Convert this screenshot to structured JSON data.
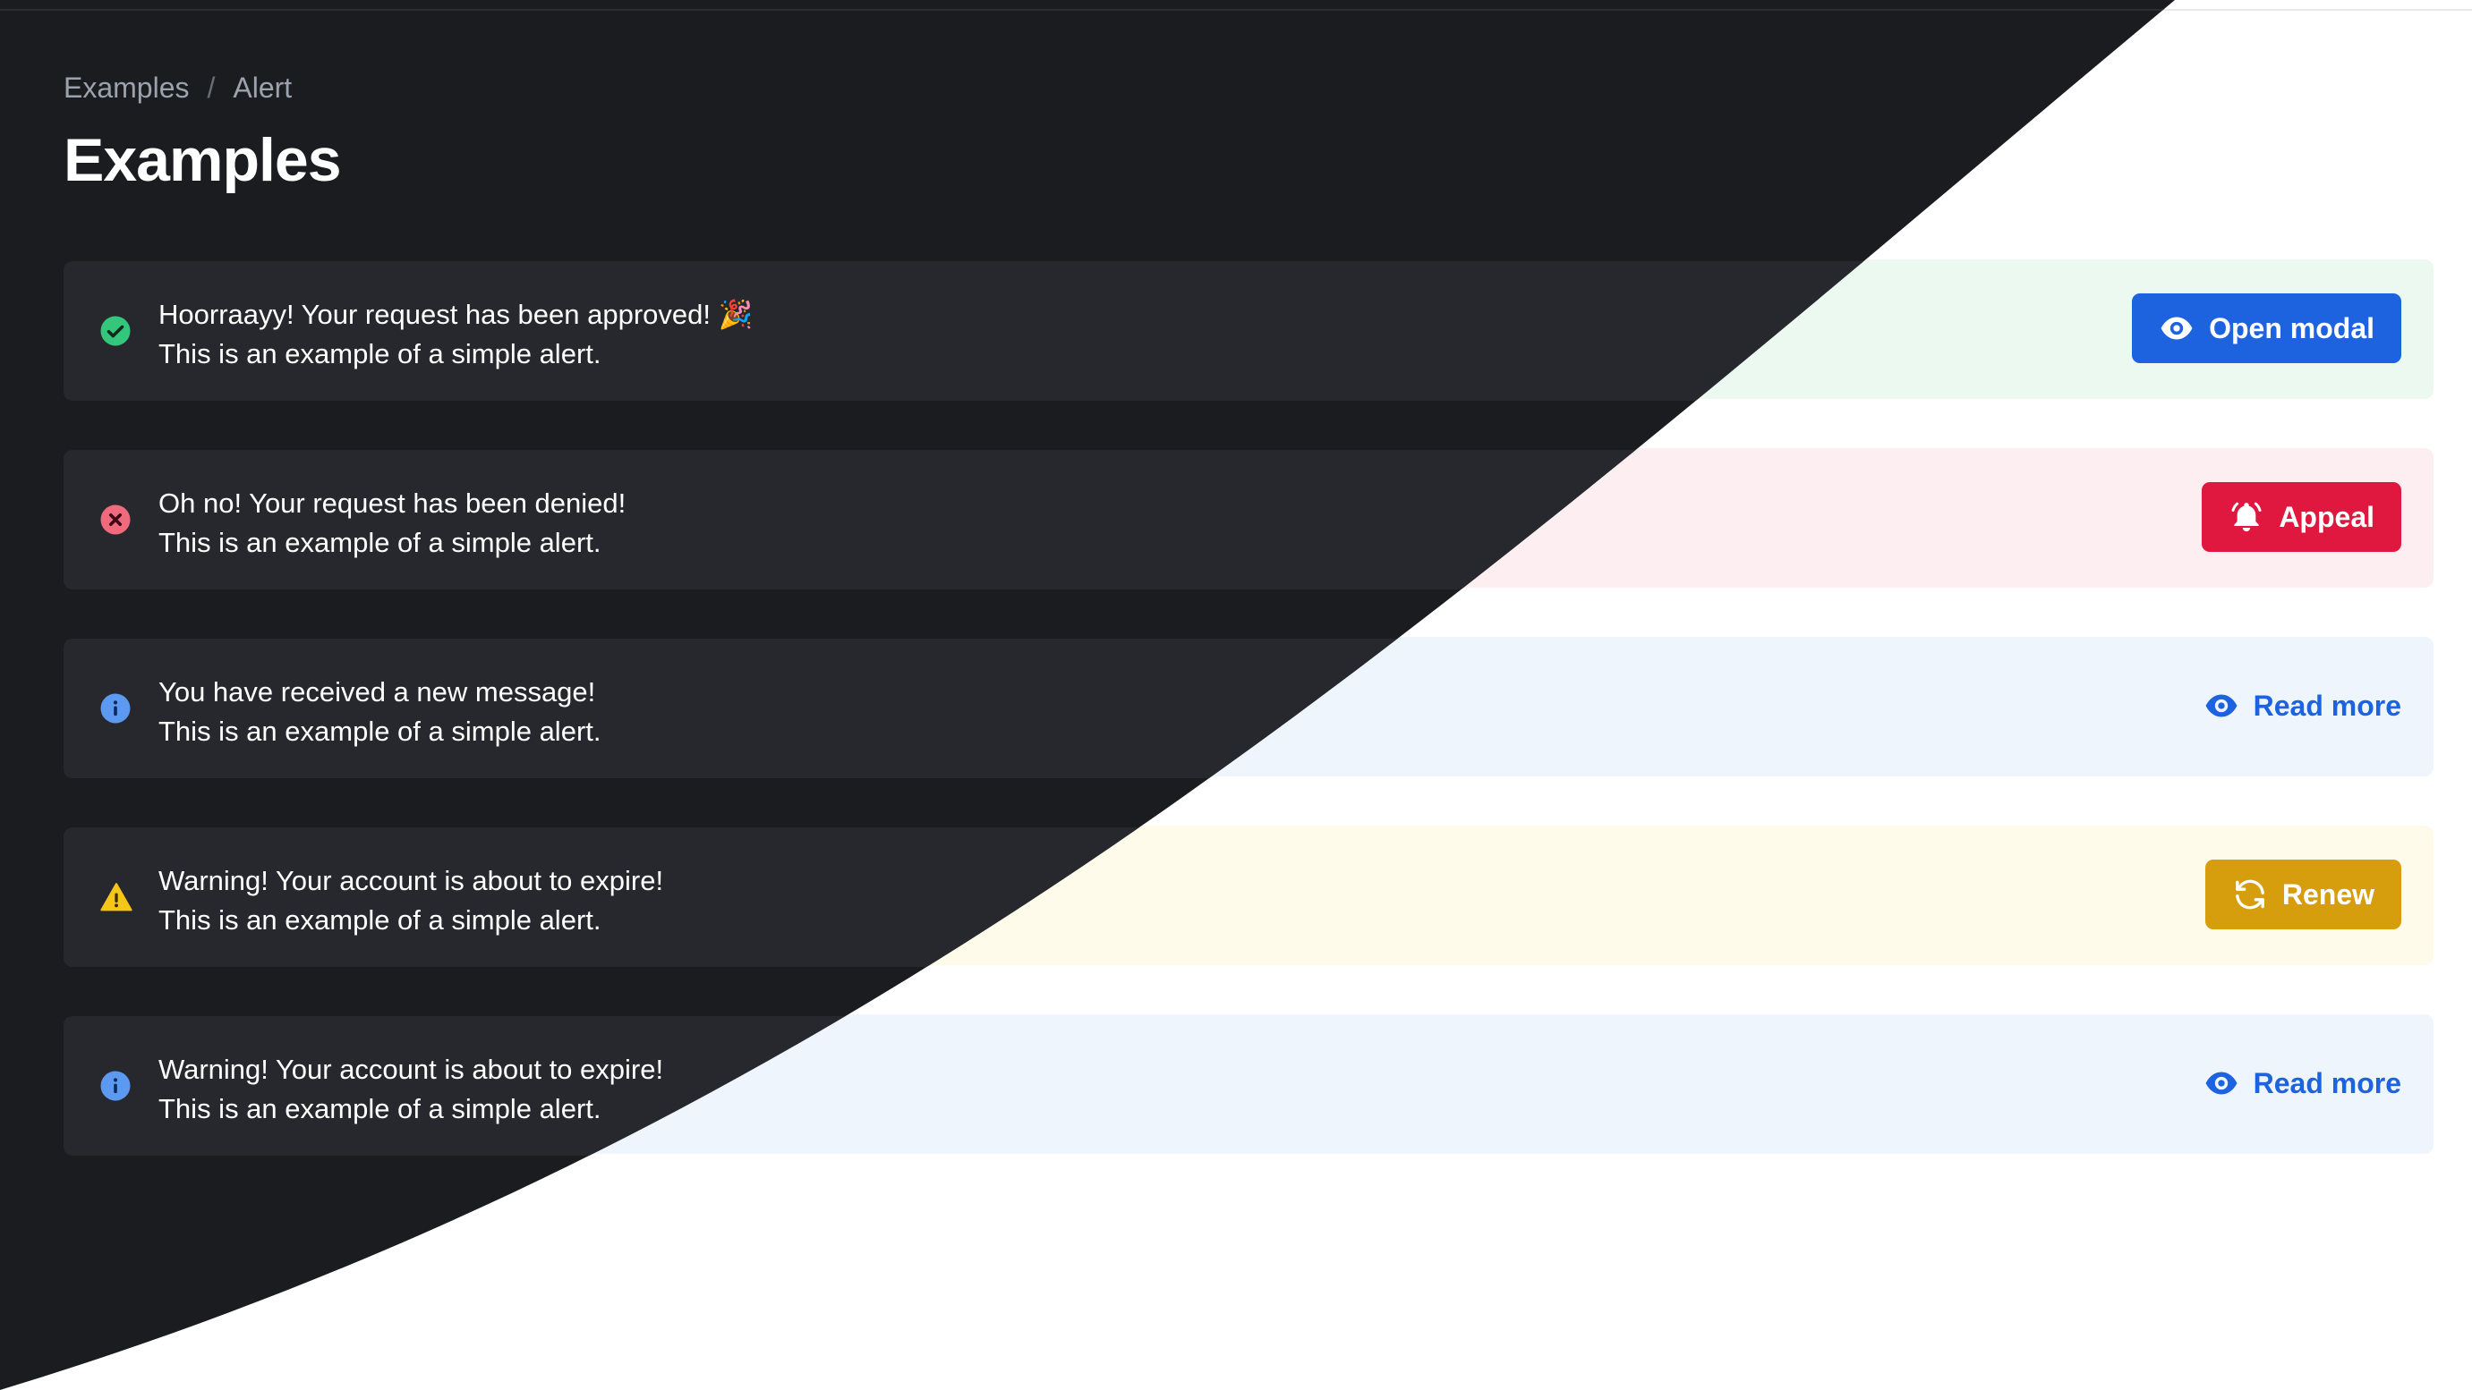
{
  "breadcrumb": {
    "items": [
      "Examples",
      "Alert"
    ],
    "separator": "/"
  },
  "page": {
    "title": "Examples"
  },
  "alerts": [
    {
      "variant": "success",
      "title": "Hoorraayy! Your request has been approved! 🎉",
      "description": "This is an example of a simple alert.",
      "icon": "check-circle-icon",
      "action": {
        "label": "Open modal",
        "icon": "eye-icon",
        "style": "primary"
      }
    },
    {
      "variant": "error",
      "title": "Oh no! Your request has been denied!",
      "description": "This is an example of a simple alert.",
      "icon": "x-circle-icon",
      "action": {
        "label": "Appeal",
        "icon": "bell-icon",
        "style": "danger"
      }
    },
    {
      "variant": "info",
      "title": "You have received a new message!",
      "description": "This is an example of a simple alert.",
      "icon": "info-circle-icon",
      "action": {
        "label": "Read more",
        "icon": "eye-icon",
        "style": "link"
      }
    },
    {
      "variant": "warning",
      "title": "Warning! Your account is about to expire!",
      "description": "This is an example of a simple alert.",
      "icon": "warning-triangle-icon",
      "action": {
        "label": "Renew",
        "icon": "refresh-icon",
        "style": "warning"
      }
    },
    {
      "variant": "info",
      "title": "Warning! Your account is about to expire!",
      "description": "This is an example of a simple alert.",
      "icon": "info-circle-icon",
      "action": {
        "label": "Read more",
        "icon": "eye-icon",
        "style": "link"
      }
    }
  ],
  "colors": {
    "dark_background": "#1b1c20",
    "dark_alert": "#27282d",
    "success_icon": "#34c77b",
    "error_icon": "#f06a7e",
    "info_icon": "#5b9af0",
    "warning_icon": "#f5c518",
    "primary": "#1d63e0",
    "danger": "#e0183f",
    "warning_button": "#d69e0c"
  }
}
